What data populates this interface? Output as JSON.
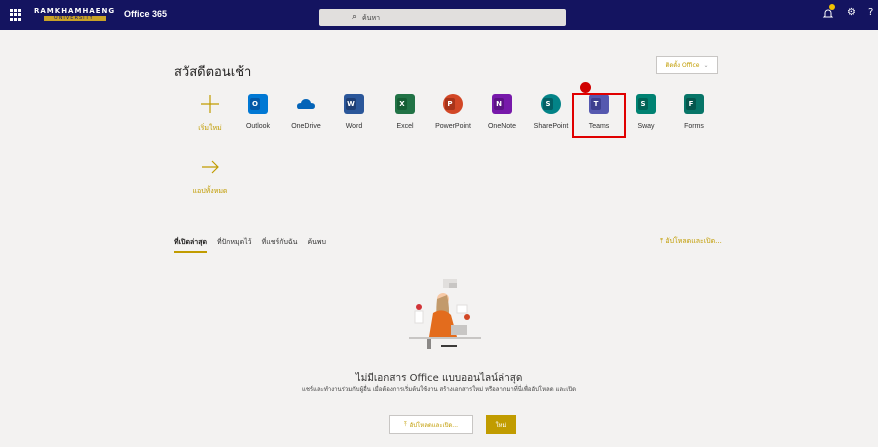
{
  "topbar": {
    "logo_text": "RAMKHAMHAENG",
    "logo_sub": "UNIVERSITY",
    "app_name": "Office 365",
    "search_placeholder": "ค้นหา",
    "settings_icon": "gear-icon",
    "help_label": "?"
  },
  "home": {
    "greeting": "สวัสดีตอนเช้า",
    "install_label": "ติดตั้ง Office",
    "apps": [
      {
        "label": "เริ่มใหม่",
        "icon": "plus-icon",
        "color": "#c19c00"
      },
      {
        "label": "Outlook",
        "icon": "outlook-icon",
        "color": "#0078d4",
        "letter": "O"
      },
      {
        "label": "OneDrive",
        "icon": "onedrive-icon",
        "color": "#0364b8"
      },
      {
        "label": "Word",
        "icon": "word-icon",
        "color": "#2b579a",
        "letter": "W"
      },
      {
        "label": "Excel",
        "icon": "excel-icon",
        "color": "#217346",
        "letter": "X"
      },
      {
        "label": "PowerPoint",
        "icon": "powerpoint-icon",
        "color": "#d24726",
        "letter": "P"
      },
      {
        "label": "OneNote",
        "icon": "onenote-icon",
        "color": "#7719aa",
        "letter": "N"
      },
      {
        "label": "SharePoint",
        "icon": "sharepoint-icon",
        "color": "#038387",
        "letter": "S"
      },
      {
        "label": "Teams",
        "icon": "teams-icon",
        "color": "#5558af",
        "letter": "T"
      },
      {
        "label": "Sway",
        "icon": "sway-icon",
        "color": "#008272",
        "letter": "S"
      },
      {
        "label": "Forms",
        "icon": "forms-icon",
        "color": "#077568",
        "letter": "F"
      }
    ],
    "more_apps_label": "แอปทั้งหมด",
    "tabs": [
      "ที่เปิดล่าสุด",
      "ที่ปักหมุดไว้",
      "ที่แชร์กับฉัน",
      "ค้นพบ"
    ],
    "upload_link": "อัปโหลดและเปิด...",
    "empty_title": "ไม่มีเอกสาร Office แบบออนไลน์ล่าสุด",
    "empty_desc": "แชร์และทำงานร่วมกับผู้อื่น เมื่อต้องการเริ่มต้นใช้งาน สร้างเอกสารใหม่ หรือลากมาที่นี่เพื่ออัปโหลด และเปิด",
    "btn_upload": "อัปโหลดและเปิด...",
    "btn_new": "ใหม่"
  }
}
